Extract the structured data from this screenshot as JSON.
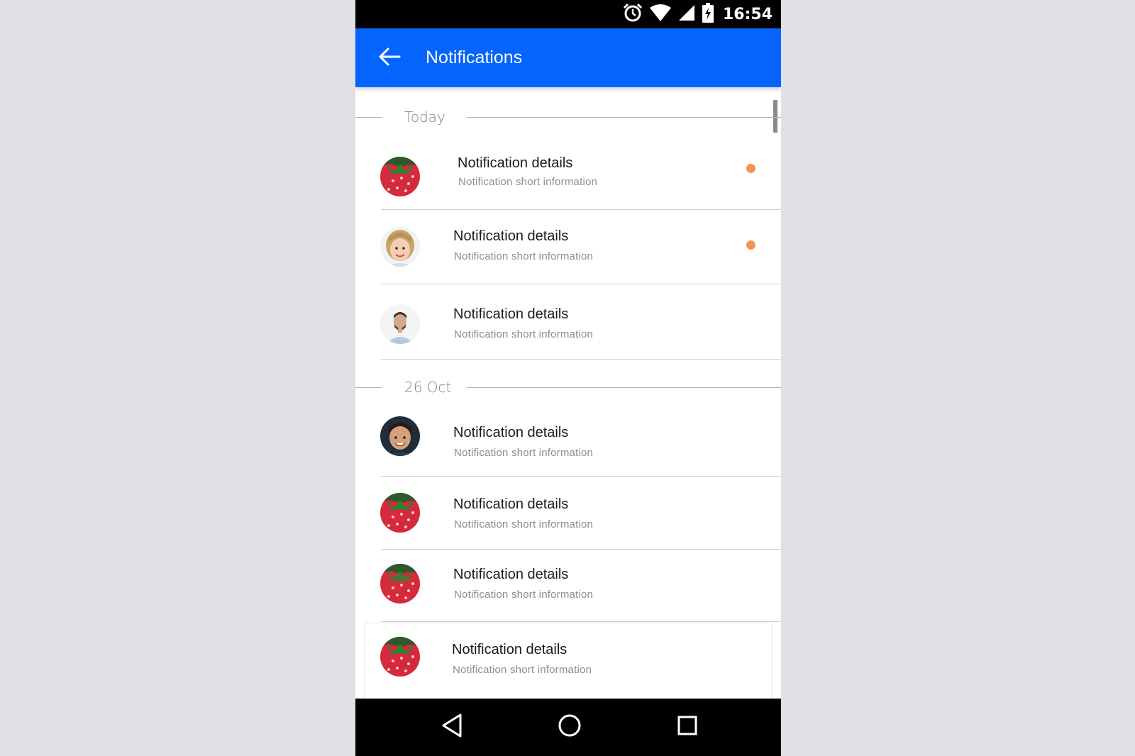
{
  "status_bar": {
    "time": "16:54",
    "icons": [
      "alarm-icon",
      "wifi-icon",
      "cellular-signal-icon",
      "battery-charging-icon"
    ]
  },
  "app_bar": {
    "title": "Notifications",
    "back_icon": "arrow-left-icon",
    "color": "#0464fc"
  },
  "sections": [
    {
      "label": "Today",
      "items": [
        {
          "title": "Notification details",
          "subtitle": "Notification short information",
          "avatar": "strawberry-avatar",
          "unread": true
        },
        {
          "title": "Notification details",
          "subtitle": "Notification short information",
          "avatar": "girl-avatar",
          "unread": true
        },
        {
          "title": "Notification details",
          "subtitle": "Notification short information",
          "avatar": "man-avatar",
          "unread": false
        }
      ]
    },
    {
      "label": "26 Oct",
      "items": [
        {
          "title": "Notification details",
          "subtitle": "Notification short information",
          "avatar": "boy-avatar",
          "unread": false
        },
        {
          "title": "Notification details",
          "subtitle": "Notification short information",
          "avatar": "strawberry-avatar",
          "unread": false
        },
        {
          "title": "Notification details",
          "subtitle": "Notification short information",
          "avatar": "strawberry-avatar",
          "unread": false
        },
        {
          "title": "Notification details",
          "subtitle": "Notification short information",
          "avatar": "strawberry-avatar",
          "unread": false
        }
      ]
    }
  ],
  "unread_dot_color": "#f5934e",
  "nav_bar": {
    "icons": [
      "back-triangle-icon",
      "home-circle-icon",
      "recents-square-icon"
    ]
  }
}
